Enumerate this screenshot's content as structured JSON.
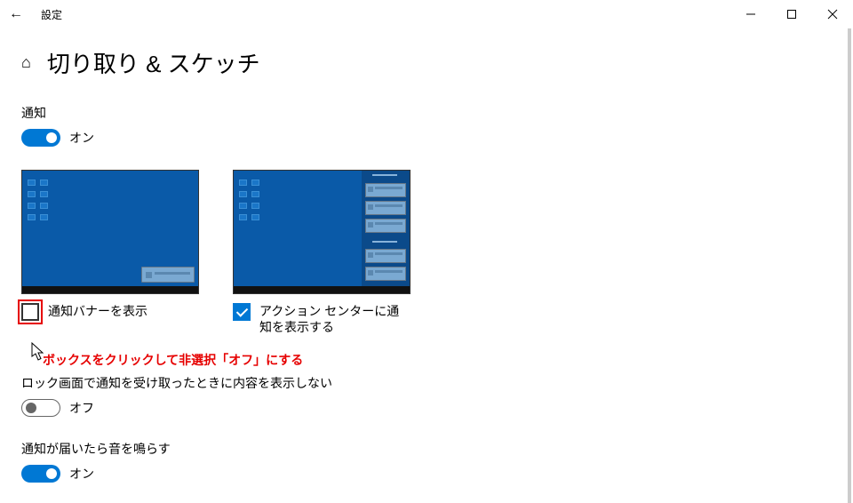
{
  "titlebar": {
    "title": "設定"
  },
  "page": {
    "title": "切り取り & スケッチ"
  },
  "sections": {
    "notify_label": "通知",
    "notify_toggle": {
      "state": "on",
      "text": "オン"
    },
    "banner_check_label": "通知バナーを表示",
    "action_center_check_label": "アクション センターに通知を表示する",
    "annotation": "ボックスをクリックして非選択「オフ」にする",
    "lock_label": "ロック画面で通知を受け取ったときに内容を表示しない",
    "lock_toggle": {
      "state": "off",
      "text": "オフ"
    },
    "sound_label": "通知が届いたら音を鳴らす",
    "sound_toggle": {
      "state": "on",
      "text": "オン"
    }
  }
}
